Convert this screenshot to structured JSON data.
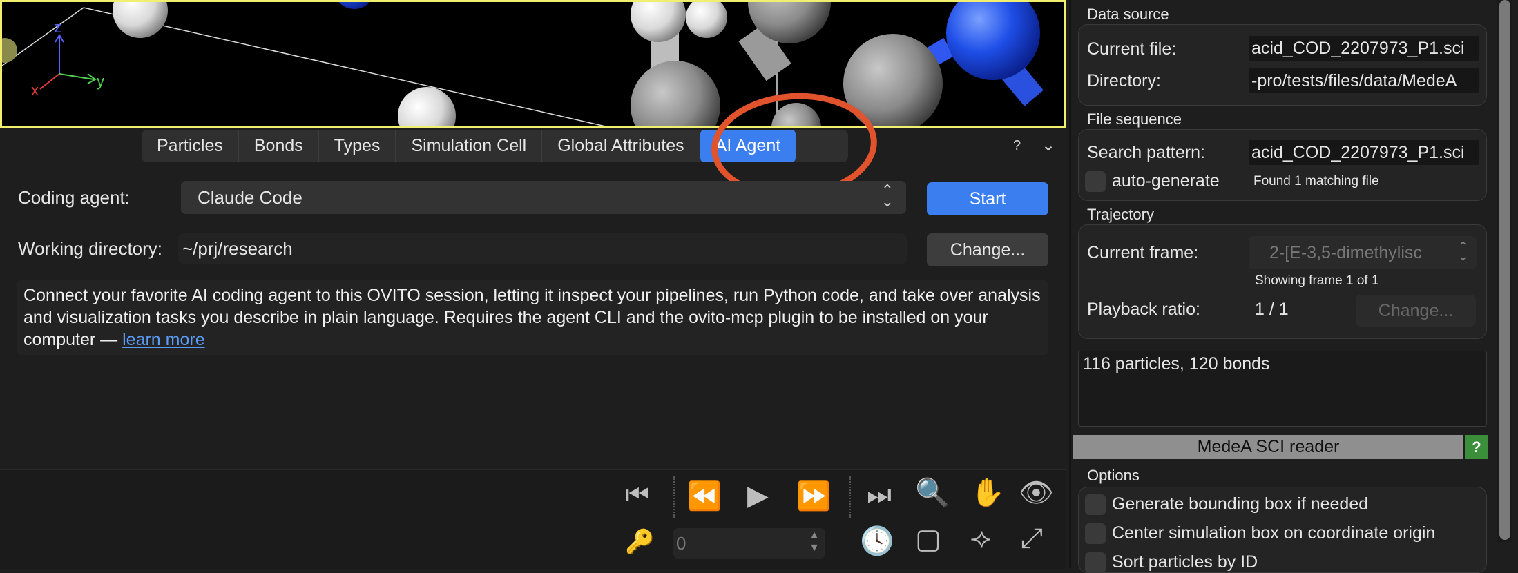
{
  "viewport": {
    "axes": {
      "x": "x",
      "y": "y",
      "z": "z"
    }
  },
  "tabs": [
    {
      "label": "Particles"
    },
    {
      "label": "Bonds"
    },
    {
      "label": "Types"
    },
    {
      "label": "Simulation Cell"
    },
    {
      "label": "Global Attributes"
    },
    {
      "label": "AI Agent",
      "active": true
    }
  ],
  "tab_help": "?",
  "agent": {
    "coding_agent_label": "Coding agent:",
    "coding_agent_value": "Claude Code",
    "start_label": "Start",
    "working_dir_label": "Working directory:",
    "working_dir_value": "~/prj/research",
    "change_label": "Change...",
    "description": "Connect your favorite AI coding agent to this OVITO session, letting it inspect your pipelines, run Python code, and take over analysis and visualization tasks you describe in plain language. Requires the agent CLI and the ovito-mcp plugin to be installed on your computer — ",
    "learn_more": "learn more"
  },
  "animation": {
    "frame_value": "0"
  },
  "right_panel": {
    "data_source_title": "Data source",
    "current_file_label": "Current file:",
    "current_file_value": "acid_COD_2207973_P1.sci",
    "directory_label": "Directory:",
    "directory_value": "-pro/tests/files/data/MedeA",
    "file_sequence_title": "File sequence",
    "search_pattern_label": "Search pattern:",
    "search_pattern_value": "acid_COD_2207973_P1.sci",
    "auto_generate_label": "auto-generate",
    "found_text": "Found 1 matching file",
    "trajectory_title": "Trajectory",
    "current_frame_label": "Current frame:",
    "current_frame_value": "2-[E-3,5-dimethylisc",
    "showing_frame": "Showing frame 1 of 1",
    "playback_label": "Playback ratio:",
    "playback_value": "1 / 1",
    "playback_change": "Change...",
    "status": "116 particles, 120 bonds",
    "reader_title": "MedeA SCI reader",
    "reader_help": "?",
    "options_title": "Options",
    "options": [
      "Generate bounding box if needed",
      "Center simulation box on coordinate origin",
      "Sort particles by ID"
    ]
  },
  "colors": {
    "accent": "#3a7ef0",
    "annotation": "#e0532c",
    "viewport_border": "#f2ee6e"
  }
}
